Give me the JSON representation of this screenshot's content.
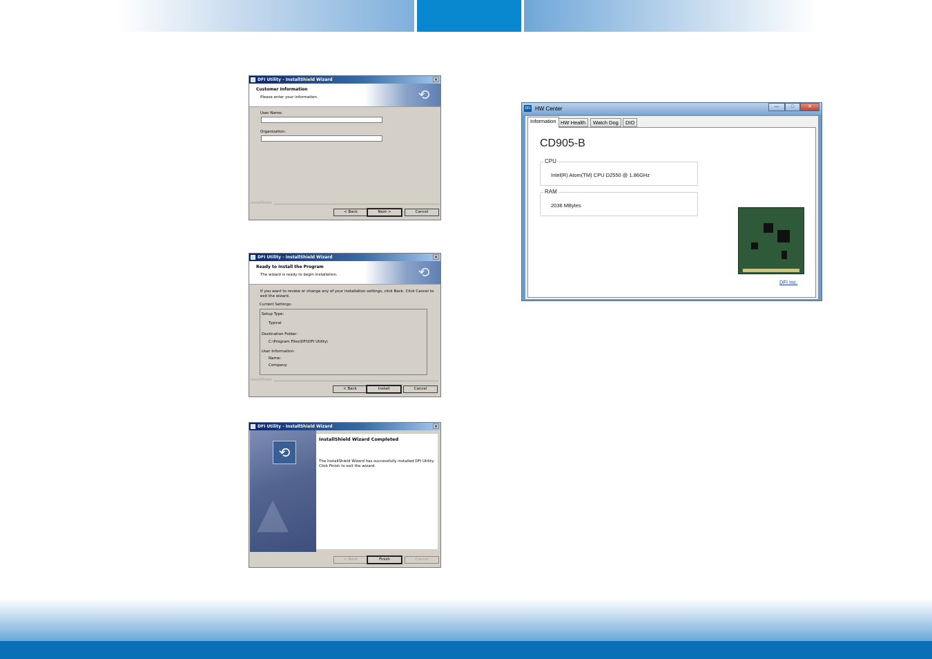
{
  "wizard1": {
    "title": "DFI Utility - InstallShield Wizard",
    "close": "×",
    "heading": "Customer Information",
    "subheading": "Please enter your information.",
    "user_name_label": "User Name:",
    "user_name_value": "",
    "organization_label": "Organization:",
    "organization_value": "",
    "brand": "InstallShield",
    "back": "< Back",
    "next": "Next >",
    "cancel": "Cancel"
  },
  "wizard2": {
    "title": "DFI Utility - InstallShield Wizard",
    "close": "×",
    "heading": "Ready to Install the Program",
    "subheading": "The wizard is ready to begin installation.",
    "intro_line1": "If you want to review or change any of your installation settings, click Back. Click Cancel to",
    "intro_line2": "exit the wizard.",
    "current_settings": "Current Settings:",
    "setup_type_label": "Setup Type:",
    "setup_type_value": "Typical",
    "destination_label": "Destination Folder:",
    "destination_value": "C:\\Program Files\\DFI\\DFI Utility\\",
    "user_info_label": "User Information:",
    "name_label": "Name:",
    "company_label": "Company:",
    "brand": "InstallShield",
    "back": "< Back",
    "install": "Install",
    "cancel": "Cancel"
  },
  "wizard3": {
    "title": "DFI Utility - InstallShield Wizard",
    "close": "×",
    "heading": "InstallShield Wizard Completed",
    "message_line1": "The InstallShield Wizard has successfully installed DFI Utility.",
    "message_line2": "Click Finish to exit the wizard.",
    "back": "< Back",
    "finish": "Finish",
    "cancel": "Cancel"
  },
  "hw_center": {
    "title": "HW Center",
    "app_icon": "DFI",
    "tabs": [
      "Information",
      "HW Health",
      "Watch Dog",
      "DIO"
    ],
    "active_tab": "Information",
    "model": "CD905-B",
    "cpu_label": "CPU",
    "cpu_value": "Intel(R) Atom(TM) CPU D2550   @ 1.86GHz",
    "ram_label": "RAM",
    "ram_value": "2036 MBytes",
    "link": "DFI Inc.",
    "minimize": "—",
    "maximize": "□",
    "close": "✕"
  },
  "colors": {
    "header_blue": "#0a88cf",
    "footer_blue": "#0a6fb6",
    "link_blue": "#1a3fb0"
  }
}
